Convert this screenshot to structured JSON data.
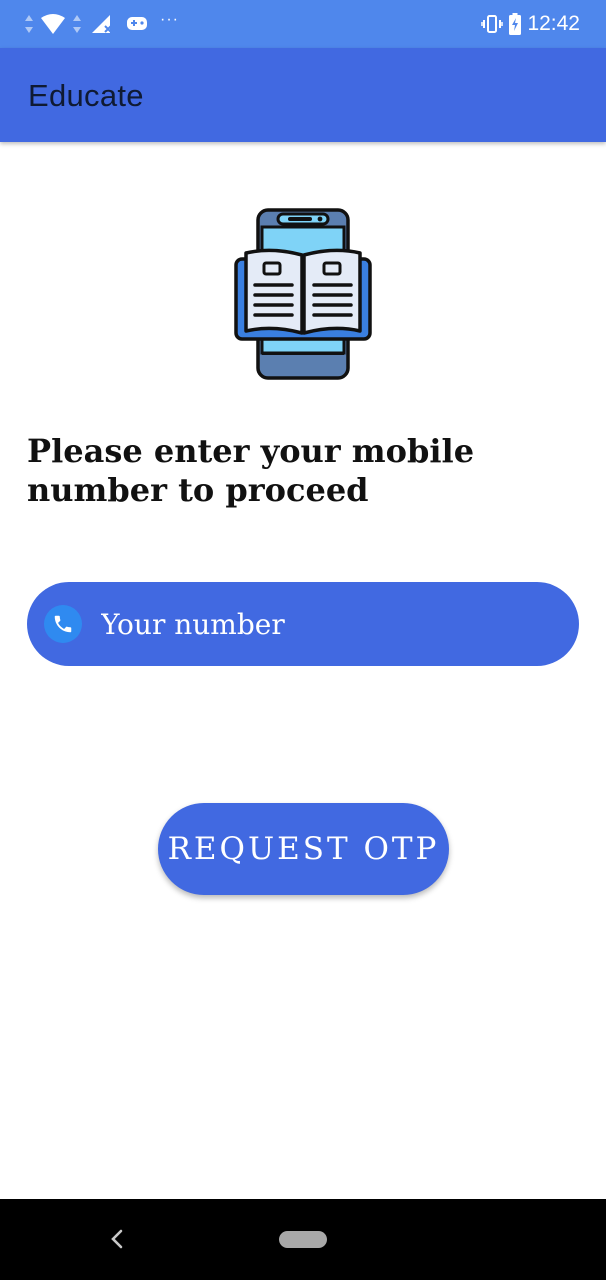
{
  "status_bar": {
    "time": "12:42",
    "left_icons": [
      "data-arrows-icon",
      "wifi-icon",
      "data-arrows-icon",
      "signal-no-sim-icon",
      "game-controller-icon"
    ],
    "overflow": "···",
    "right_icons": [
      "vibrate-icon",
      "battery-charging-icon"
    ]
  },
  "app_bar": {
    "title": "Educate"
  },
  "illustration": {
    "icon": "phone-open-book-icon"
  },
  "prompt": {
    "text": "Please enter your mobile number to proceed"
  },
  "phone_field": {
    "icon": "phone-icon",
    "placeholder": "Your number",
    "value": ""
  },
  "otp_button": {
    "label": "REQUEST OTP"
  },
  "nav_bar": {
    "back_icon": "back-chevron-icon",
    "home_icon": "home-pill-icon"
  },
  "colors": {
    "status_bar": "#4f87ec",
    "primary": "#4169e1",
    "icon_accent": "#2f8af0",
    "text_dark": "#111111",
    "nav_bar": "#000000"
  }
}
